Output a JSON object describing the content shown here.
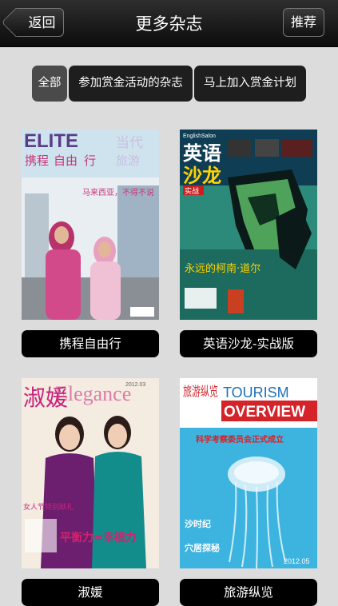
{
  "nav": {
    "back_label": "返回",
    "title": "更多杂志",
    "recommend_label": "推荐"
  },
  "filters": [
    "全部",
    "参加赏金活动的杂志",
    "马上加入赏金计划"
  ],
  "magazines": [
    {
      "title": "携程自由行",
      "cover": {
        "masthead": "ELITE",
        "masthead_cn": "当代",
        "subtitle": "携程",
        "subtitle2": "自由",
        "subtitle3": "行",
        "subtitle4": "旅游",
        "line": "马来西亚，不得不说",
        "colors": {
          "primary": "#5a3d8a",
          "accent": "#c8357a",
          "sky": "#cfe3ee"
        }
      }
    },
    {
      "title": "英语沙龙-实战版",
      "cover": {
        "masthead_top": "EnglishSalon",
        "masthead": "英语",
        "masthead2": "沙龙",
        "tag": "实战",
        "headline": "永远的柯南·道尔",
        "colors": {
          "primary": "#1a4f6e",
          "accent": "#ffd400",
          "bg": "#2b8a7a"
        }
      }
    },
    {
      "title": "淑媛",
      "cover": {
        "masthead": "Elegance",
        "masthead_cn": "淑媛",
        "issue": "2012.03",
        "headline": "平衡力=幸福力",
        "side_text": "女人节特别献礼",
        "colors": {
          "primary": "#c8237e",
          "accent": "#e8d9c2",
          "bg": "#f4ebe1"
        }
      }
    },
    {
      "title": "旅游纵览",
      "cover": {
        "masthead_cn": "旅游纵览",
        "masthead": "TOURISM",
        "masthead2": "OVERVIEW",
        "headline": "科学考察委员会正式成立",
        "footer": "沙时纪",
        "footer2": "穴居探秘",
        "issue": "2012.05",
        "colors": {
          "primary": "#1e6fb5",
          "accent": "#d4242a",
          "bg": "#3db3e0"
        }
      }
    }
  ]
}
